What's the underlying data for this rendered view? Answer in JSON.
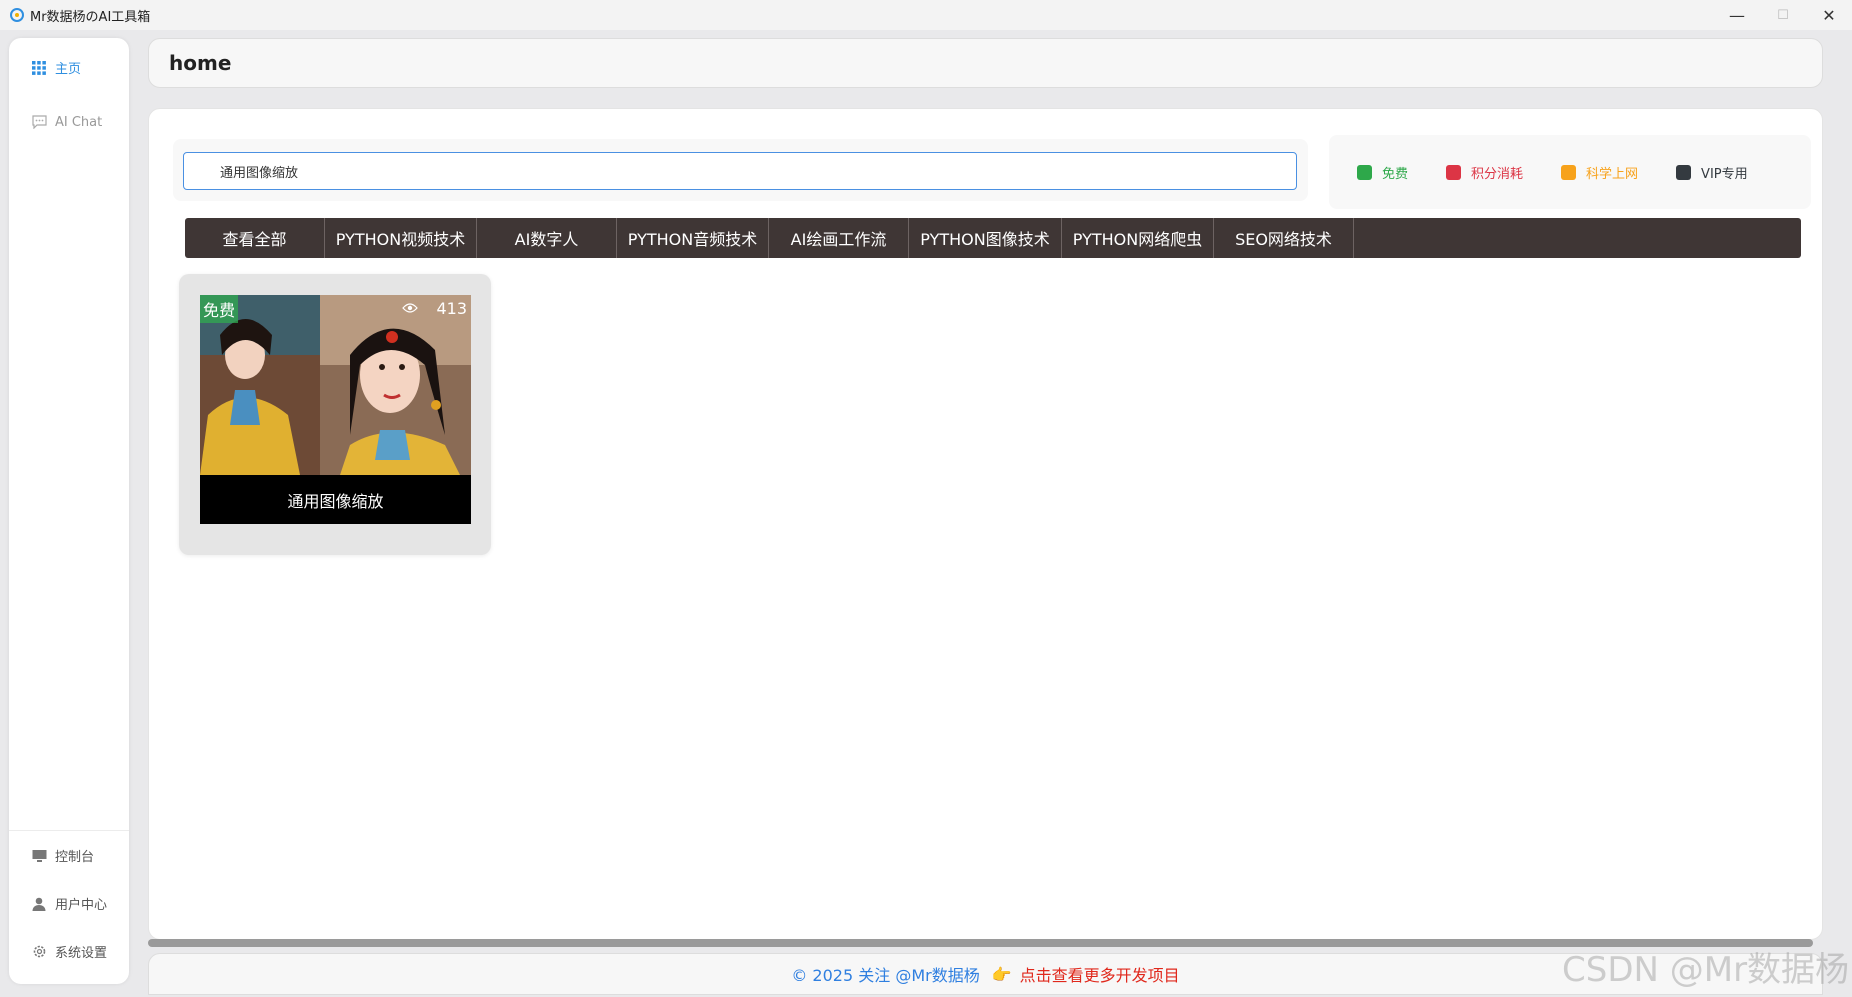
{
  "window": {
    "title": "Mr数据杨のAI工具箱",
    "minimize": "—",
    "maximize": "☐",
    "close": "✕"
  },
  "sidebar": {
    "items": [
      {
        "label": "主页",
        "icon": "grid-icon",
        "active": true
      },
      {
        "label": "AI Chat",
        "icon": "chat-icon",
        "active": false
      }
    ],
    "bottom_items": [
      {
        "label": "控制台",
        "icon": "monitor-icon"
      },
      {
        "label": "用户中心",
        "icon": "user-icon"
      },
      {
        "label": "系统设置",
        "icon": "gear-icon"
      }
    ]
  },
  "header": {
    "title": "home"
  },
  "search": {
    "value": "通用图像缩放"
  },
  "legend": [
    {
      "label": "免费",
      "color": "#2ea84a"
    },
    {
      "label": "积分消耗",
      "color": "#dc3545"
    },
    {
      "label": "科学上网",
      "color": "#f7a21b"
    },
    {
      "label": "VIP专用",
      "color": "#343a40"
    }
  ],
  "tabs": [
    {
      "label": "查看全部"
    },
    {
      "label": "PYTHON视频技术"
    },
    {
      "label": "AI数字人"
    },
    {
      "label": "PYTHON音频技术"
    },
    {
      "label": "AI绘画工作流"
    },
    {
      "label": "PYTHON图像技术"
    },
    {
      "label": "PYTHON网络爬虫"
    },
    {
      "label": "SEO网络技术"
    }
  ],
  "cards": [
    {
      "title": "通用图像缩放",
      "badge": "免费",
      "views": "413"
    }
  ],
  "footer": {
    "copyright": "© 2025 关注 @Mr数据杨",
    "hand": "👉",
    "link": "点击查看更多开发项目"
  },
  "watermark": "CSDN @Mr数据杨"
}
